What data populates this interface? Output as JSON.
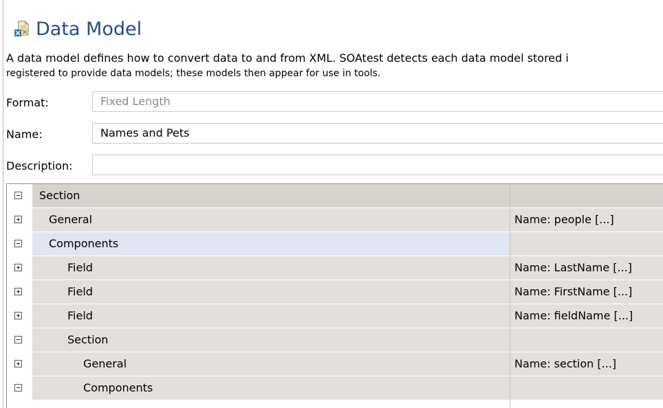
{
  "header": {
    "title": "Data Model",
    "icon": "xml-data-model-icon"
  },
  "description": {
    "line1": "A data model defines how to convert data to and from XML.  SOAtest detects each data model stored i",
    "line2": "registered to provide data models; these models then appear for use in tools."
  },
  "form": {
    "format": {
      "label": "Format:",
      "value": "Fixed Length"
    },
    "name": {
      "label": "Name:",
      "value": "Names and Pets"
    },
    "description": {
      "label": "Description:",
      "value": ""
    }
  },
  "tree": {
    "rows": [
      {
        "label": "Section",
        "value": "",
        "expanded": true
      },
      {
        "label": "General",
        "value": "Name: people [...]",
        "expanded": false
      },
      {
        "label": "Components",
        "value": "",
        "expanded": true
      },
      {
        "label": "Field",
        "value": "Name: LastName [...]",
        "expanded": false
      },
      {
        "label": "Field",
        "value": "Name: FirstName [...]",
        "expanded": false
      },
      {
        "label": "Field",
        "value": "Name: fieldName [...]",
        "expanded": false
      },
      {
        "label": "Section",
        "value": "",
        "expanded": true
      },
      {
        "label": "General",
        "value": "Name: section [...]",
        "expanded": false
      },
      {
        "label": "Components",
        "value": "",
        "expanded": true
      }
    ]
  },
  "colors": {
    "title": "#1f4f8c",
    "row_bg": "#e3dfdc",
    "selected_row_bg": "#dfe5f1"
  }
}
